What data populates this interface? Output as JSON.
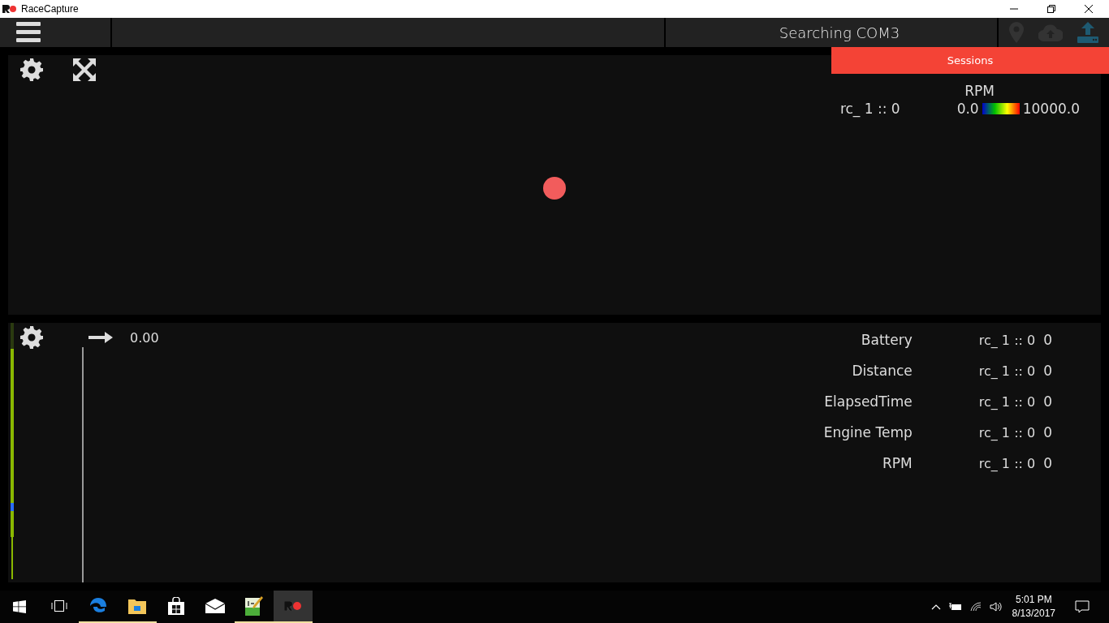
{
  "window": {
    "title": "RaceCapture"
  },
  "top_bar": {
    "status": "Searching COM3",
    "icons": [
      {
        "kind": "location",
        "disabled": true
      },
      {
        "kind": "cloud",
        "disabled": true
      },
      {
        "kind": "upload",
        "disabled": false
      }
    ]
  },
  "sessions_popup": {
    "label": "Sessions"
  },
  "map_panel": {
    "heading": "RPM",
    "legend": {
      "source": "rc_ 1 :: 0",
      "min": "0.0",
      "max": "10000.0"
    }
  },
  "channel_panel": {
    "cursor_value": "0.00",
    "channels": [
      {
        "name": "Battery",
        "source": "rc_ 1 :: 0",
        "value": "0"
      },
      {
        "name": "Distance",
        "source": "rc_ 1 :: 0",
        "value": "0"
      },
      {
        "name": "ElapsedTime",
        "source": "rc_ 1 :: 0",
        "value": "0"
      },
      {
        "name": "Engine Temp",
        "source": "rc_ 1 :: 0",
        "value": "0"
      },
      {
        "name": "RPM",
        "source": "rc_ 1 :: 0",
        "value": "0"
      }
    ]
  },
  "taskbar": {
    "apps": [
      {
        "kind": "taskview",
        "running": false,
        "active": false
      },
      {
        "kind": "edge",
        "running": true,
        "active": false
      },
      {
        "kind": "folder",
        "running": true,
        "active": false
      },
      {
        "kind": "store",
        "running": false,
        "active": false
      },
      {
        "kind": "mail",
        "running": false,
        "active": false
      },
      {
        "kind": "notepad",
        "running": true,
        "active": false
      },
      {
        "kind": "racecapture",
        "running": true,
        "active": true
      }
    ],
    "time": "5:01 PM",
    "date": "8/13/2017"
  }
}
